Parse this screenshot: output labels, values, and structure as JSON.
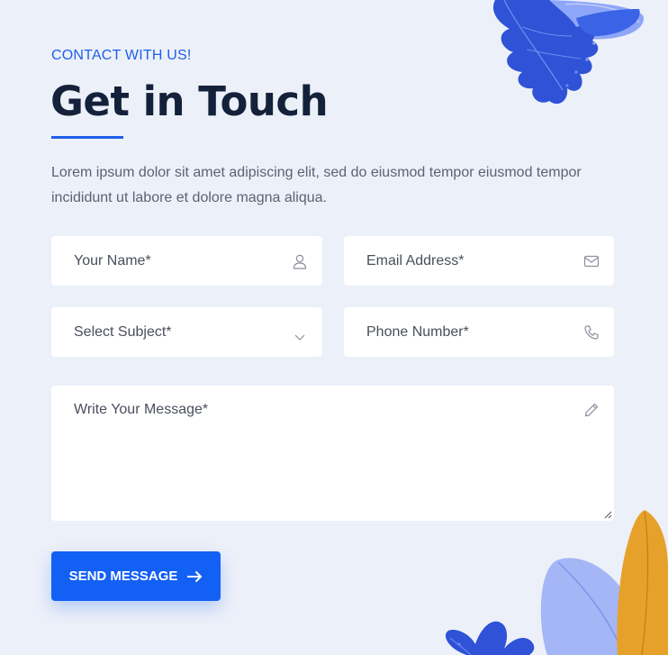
{
  "header": {
    "eyebrow": "CONTACT WITH US!",
    "title": "Get in Touch",
    "description": "Lorem ipsum dolor sit amet adipiscing elit, sed do eiusmod tempor eiusmod tempor incididunt ut labore et dolore magna aliqua."
  },
  "form": {
    "name_placeholder": "Your Name*",
    "email_placeholder": "Email Address*",
    "subject_placeholder": "Select Subject*",
    "phone_placeholder": "Phone Number*",
    "message_placeholder": "Write Your Message*",
    "submit_label": "SEND MESSAGE"
  },
  "icons": {
    "name": "user-icon",
    "email": "mail-icon",
    "subject": "chevron-down-icon",
    "phone": "phone-icon",
    "message": "pencil-icon",
    "submit": "arrow-right-icon"
  },
  "colors": {
    "background": "#ecf0f9",
    "accent": "#1360f5",
    "heading": "#14213a",
    "text": "#5c6272"
  }
}
